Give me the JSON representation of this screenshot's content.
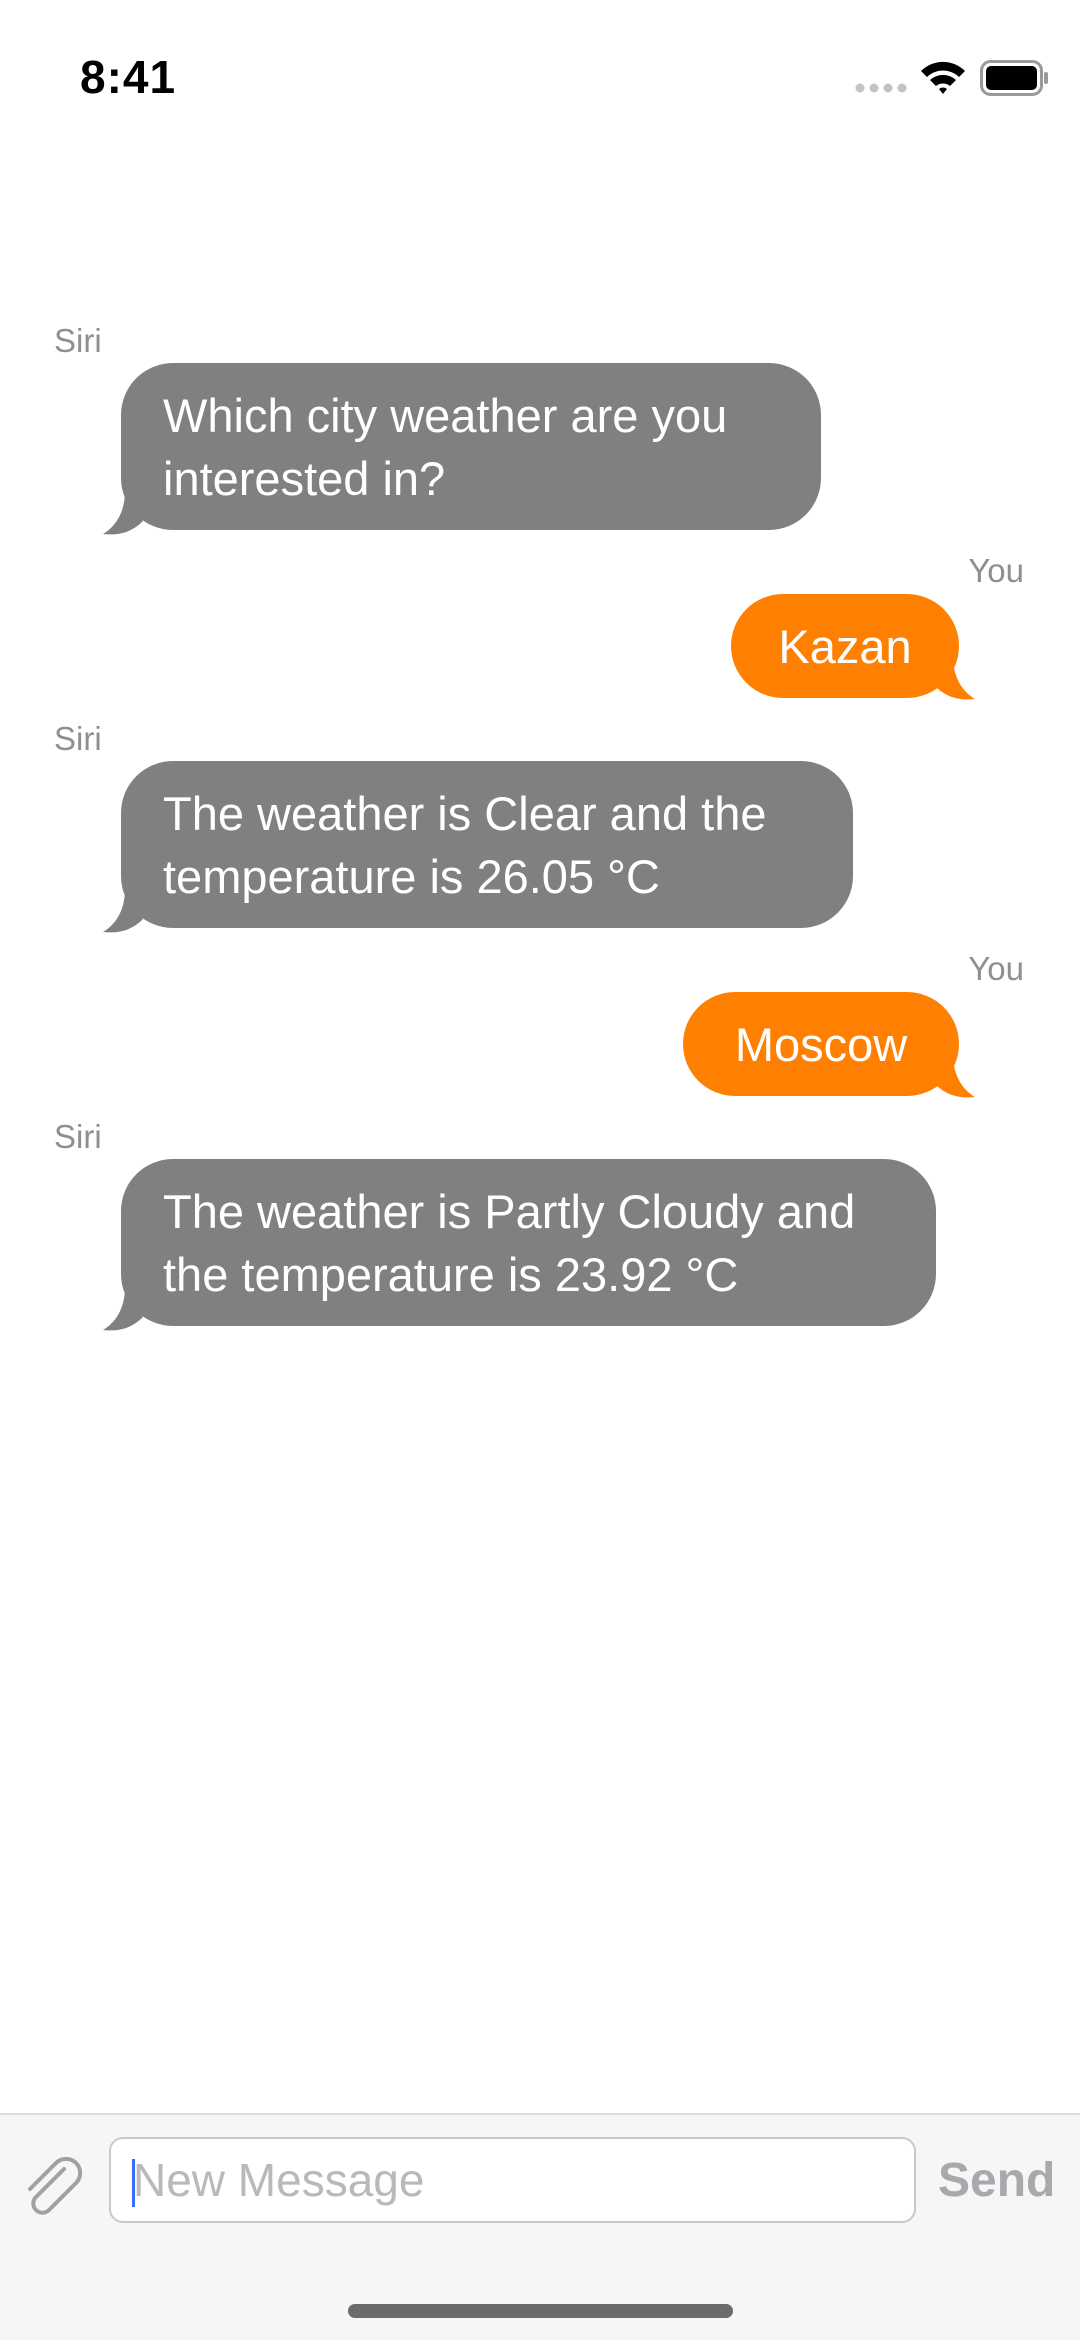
{
  "status_bar": {
    "time": "8:41",
    "icons": [
      "signal-icon",
      "wifi-icon",
      "battery-icon"
    ]
  },
  "messages": [
    {
      "sender": "Siri",
      "direction": "incoming",
      "lines": [
        "Which city weather are you",
        "interested in?"
      ]
    },
    {
      "sender": "You",
      "direction": "outgoing",
      "lines": [
        "Kazan"
      ]
    },
    {
      "sender": "Siri",
      "direction": "incoming",
      "lines": [
        "The weather is Clear and the",
        "temperature is 26.05 °C"
      ]
    },
    {
      "sender": "You",
      "direction": "outgoing",
      "lines": [
        "Moscow"
      ]
    },
    {
      "sender": "Siri",
      "direction": "incoming",
      "lines": [
        "The weather is Partly Cloudy and",
        "the temperature is 23.92 °C"
      ]
    }
  ],
  "composer": {
    "attach_icon": "paperclip-icon",
    "placeholder": "New Message",
    "value": "",
    "send_label": "Send"
  },
  "colors": {
    "incoming_bubble": "#808080",
    "outgoing_bubble": "#ff8000",
    "sender_label": "#8e8e93",
    "send_disabled": "#a8a8ad"
  }
}
